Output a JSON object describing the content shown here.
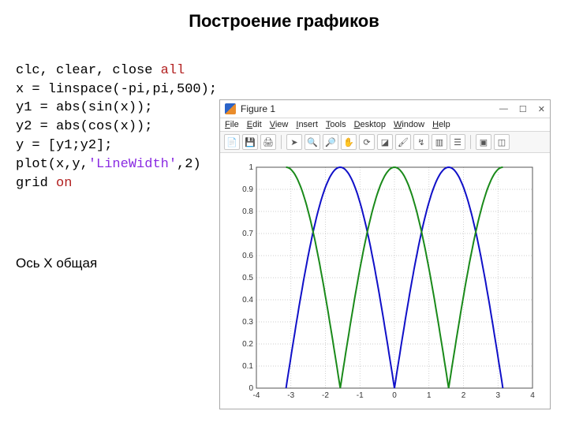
{
  "title": "Построение графиков",
  "code": {
    "l1a": "clc, clear, close ",
    "l1b": "all",
    "l2": "x = linspace(-pi,pi,500);",
    "l3": "y1 = abs(sin(x));",
    "l4": "y2 = abs(cos(x));",
    "l5": "y = [y1;y2];",
    "l6a": "plot(x,y,",
    "l6b": "'LineWidth'",
    "l6c": ",2)",
    "l7a": "grid ",
    "l7b": "on"
  },
  "note": "Ось X общая",
  "figure": {
    "title": "Figure 1",
    "win_min": "—",
    "win_max": "☐",
    "win_close": "✕",
    "menu": {
      "file": "File",
      "edit": "Edit",
      "view": "View",
      "insert": "Insert",
      "tools": "Tools",
      "desktop": "Desktop",
      "window": "Window",
      "help": "Help"
    },
    "xticks": [
      "-4",
      "-3",
      "-2",
      "-1",
      "0",
      "1",
      "2",
      "3",
      "4"
    ],
    "yticks": [
      "0",
      "0.1",
      "0.2",
      "0.3",
      "0.4",
      "0.5",
      "0.6",
      "0.7",
      "0.8",
      "0.9",
      "1"
    ]
  },
  "chart_data": {
    "type": "line",
    "title": "",
    "xlabel": "",
    "ylabel": "",
    "xlim": [
      -4,
      4
    ],
    "ylim": [
      0,
      1
    ],
    "grid": true,
    "x": [
      -3.14,
      -2.9,
      -2.6,
      -2.3,
      -2.0,
      -1.7,
      -1.5708,
      -1.4,
      -1.1,
      -0.8,
      -0.5,
      -0.2,
      0,
      0.2,
      0.5,
      0.8,
      1.1,
      1.4,
      1.5708,
      1.7,
      2.0,
      2.3,
      2.6,
      2.9,
      3.14
    ],
    "series": [
      {
        "name": "abs(sin(x))",
        "color": "#1010c8",
        "values": [
          0.0,
          0.24,
          0.52,
          0.75,
          0.91,
          0.99,
          1.0,
          0.99,
          0.89,
          0.72,
          0.48,
          0.2,
          0.0,
          0.2,
          0.48,
          0.72,
          0.89,
          0.99,
          1.0,
          0.99,
          0.91,
          0.75,
          0.52,
          0.24,
          0.0
        ]
      },
      {
        "name": "abs(cos(x))",
        "color": "#1a8a1a",
        "values": [
          1.0,
          0.97,
          0.86,
          0.67,
          0.42,
          0.13,
          0.0,
          0.17,
          0.45,
          0.7,
          0.88,
          0.98,
          1.0,
          0.98,
          0.88,
          0.7,
          0.45,
          0.17,
          0.0,
          0.13,
          0.42,
          0.67,
          0.86,
          0.97,
          1.0
        ]
      }
    ]
  }
}
